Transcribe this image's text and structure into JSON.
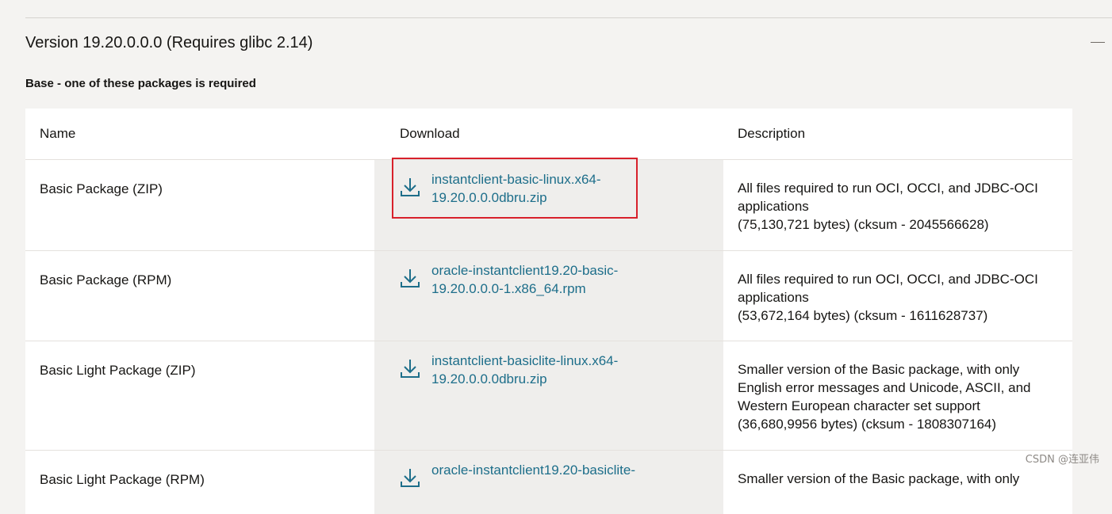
{
  "version_section": {
    "title": "Version 19.20.0.0.0 (Requires glibc 2.14)",
    "collapse_icon": "minus-icon",
    "subheading": "Base - one of these packages is required"
  },
  "table": {
    "columns": [
      "Name",
      "Download",
      "Description"
    ],
    "rows": [
      {
        "name": "Basic Package (ZIP)",
        "download_line1": "instantclient-basic-linux.x64-",
        "download_line2": "19.20.0.0.0dbru.zip",
        "desc_lines": [
          "All files required to run OCI, OCCI, and JDBC-OCI",
          "applications",
          "(75,130,721 bytes) (cksum - 2045566628)"
        ]
      },
      {
        "name": "Basic Package (RPM)",
        "download_line1": "oracle-instantclient19.20-basic-",
        "download_line2": "19.20.0.0.0-1.x86_64.rpm",
        "desc_lines": [
          "All files required to run OCI, OCCI, and JDBC-OCI",
          "applications",
          "(53,672,164 bytes) (cksum - 1611628737)"
        ]
      },
      {
        "name": "Basic Light Package (ZIP)",
        "download_line1": "instantclient-basiclite-linux.x64-",
        "download_line2": "19.20.0.0.0dbru.zip",
        "desc_lines": [
          "Smaller version of the Basic package, with only",
          "English error messages and Unicode, ASCII, and",
          "Western European character set support",
          "(36,680,9956 bytes) (cksum - 1808307164)"
        ]
      },
      {
        "name": "Basic Light Package (RPM)",
        "download_line1": "oracle-instantclient19.20-basiclite-",
        "download_line2": "",
        "desc_lines": [
          "Smaller version of the Basic package, with only"
        ]
      }
    ]
  },
  "watermark": "CSDN @连亚伟",
  "colors": {
    "link": "#1d6e8a",
    "highlight": "#d8212b",
    "page_bg": "#f4f3f1",
    "download_col_bg": "#efeeec"
  }
}
